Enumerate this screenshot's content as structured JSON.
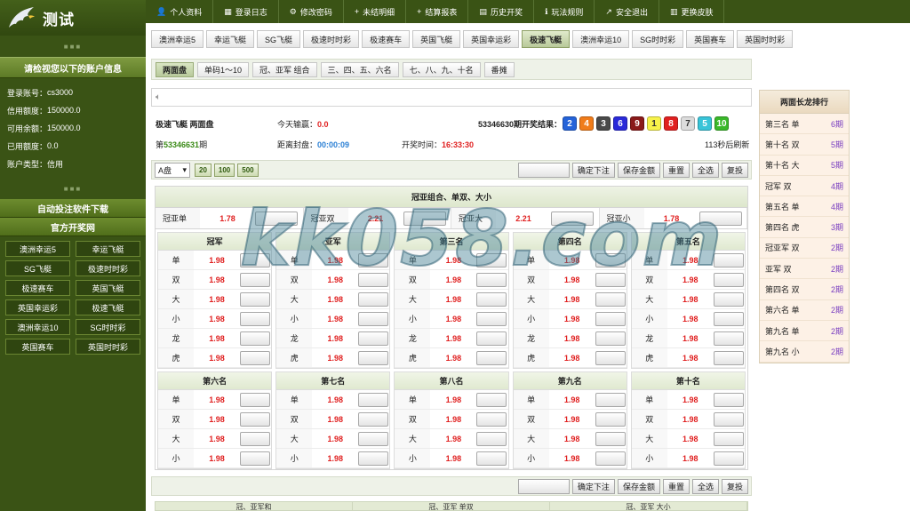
{
  "brand": {
    "title": "测试"
  },
  "sidebar": {
    "account_title": "请检视您以下的账户信息",
    "account": [
      {
        "label": "登录账号：",
        "value": "cs3000"
      },
      {
        "label": "信用额度：",
        "value": "150000.0"
      },
      {
        "label": "可用余额：",
        "value": "150000.0"
      },
      {
        "label": "已用额度：",
        "value": "0.0"
      },
      {
        "label": "账户类型：",
        "value": "信用"
      }
    ],
    "download_label": "自动投注软件下载",
    "official_label": "官方开奖网",
    "links": [
      "澳洲幸运5",
      "幸运飞艇",
      "SG飞艇",
      "极速时时彩",
      "极速赛车",
      "英国飞艇",
      "英国幸运彩",
      "极速飞艇",
      "澳洲幸运10",
      "SG时时彩",
      "英国赛车",
      "英国时时彩"
    ]
  },
  "topnav": [
    {
      "icon": "user-icon",
      "glyph": "👤",
      "label": "个人资料"
    },
    {
      "icon": "log-icon",
      "glyph": "▦",
      "label": "登录日志"
    },
    {
      "icon": "key-icon",
      "glyph": "⚙",
      "label": "修改密码"
    },
    {
      "icon": "plus-icon",
      "glyph": "+",
      "label": "未结明细"
    },
    {
      "icon": "plus-icon",
      "glyph": "+",
      "label": "结算报表"
    },
    {
      "icon": "history-icon",
      "glyph": "▤",
      "label": "历史开奖"
    },
    {
      "icon": "info-icon",
      "glyph": "ℹ",
      "label": "玩法规则"
    },
    {
      "icon": "exit-icon",
      "glyph": "↗",
      "label": "安全退出"
    },
    {
      "icon": "skin-icon",
      "glyph": "▥",
      "label": "更换皮肤"
    }
  ],
  "games": [
    "澳洲幸运5",
    "幸运飞艇",
    "SG飞艇",
    "极速时时彩",
    "极速赛车",
    "英国飞艇",
    "英国幸运彩",
    "极速飞艇",
    "澳洲幸运10",
    "SG时时彩",
    "英国赛车",
    "英国时时彩"
  ],
  "active_game": "极速飞艇",
  "plays": [
    "两面盘",
    "单码1～10",
    "冠、亚军 组合",
    "三、四、五、六名",
    "七、八、九、十名",
    "番摊"
  ],
  "active_play": "两面盘",
  "status": {
    "game_play": "极速飞艇 两面盘",
    "win_label": "今天输赢：",
    "win_value": "0.0",
    "result_label": "53346630期开奖结果：",
    "period_prefix": "第",
    "period_no": "53346631",
    "period_suffix": "期",
    "close_label": "距离封盘：",
    "close_value": "00:00:09",
    "open_label": "开奖时间：",
    "open_value": "16:33:30",
    "refresh": "113秒后刷新"
  },
  "balls": [
    {
      "n": "2",
      "bg": "#2563d9",
      "fg": "#ffffff"
    },
    {
      "n": "4",
      "bg": "#f07c1a",
      "fg": "#ffffff"
    },
    {
      "n": "3",
      "bg": "#4a4a4a",
      "fg": "#ffffff"
    },
    {
      "n": "6",
      "bg": "#2a2ad9",
      "fg": "#ffffff"
    },
    {
      "n": "9",
      "bg": "#8a1a1a",
      "fg": "#ffffff"
    },
    {
      "n": "1",
      "bg": "#f7f24a",
      "fg": "#333333"
    },
    {
      "n": "8",
      "bg": "#e02020",
      "fg": "#ffffff"
    },
    {
      "n": "7",
      "bg": "#dcdcdc",
      "fg": "#333333"
    },
    {
      "n": "5",
      "bg": "#38c4d8",
      "fg": "#ffffff"
    },
    {
      "n": "10",
      "bg": "#3ab82a",
      "fg": "#ffffff"
    }
  ],
  "toolbar": {
    "plate": "A盘",
    "quick": [
      "20",
      "100",
      "500"
    ],
    "confirm": "确定下注",
    "save": "保存金额",
    "reset": "重置",
    "select_all": "全选",
    "reverse": "复投"
  },
  "combo": {
    "title": "冠亚组合、单双、大小",
    "items": [
      {
        "label": "冠亚单",
        "odds": "1.78"
      },
      {
        "label": "冠亚双",
        "odds": "2.21"
      },
      {
        "label": "冠亚大",
        "odds": "2.21"
      },
      {
        "label": "冠亚小",
        "odds": "1.78"
      }
    ]
  },
  "ranks_top": [
    {
      "title": "冠军",
      "rows": [
        {
          "l": "单",
          "o": "1.98"
        },
        {
          "l": "双",
          "o": "1.98"
        },
        {
          "l": "大",
          "o": "1.98"
        },
        {
          "l": "小",
          "o": "1.98"
        },
        {
          "l": "龙",
          "o": "1.98"
        },
        {
          "l": "虎",
          "o": "1.98"
        }
      ]
    },
    {
      "title": "亚军",
      "rows": [
        {
          "l": "单",
          "o": "1.98"
        },
        {
          "l": "双",
          "o": "1.98"
        },
        {
          "l": "大",
          "o": "1.98"
        },
        {
          "l": "小",
          "o": "1.98"
        },
        {
          "l": "龙",
          "o": "1.98"
        },
        {
          "l": "虎",
          "o": "1.98"
        }
      ]
    },
    {
      "title": "第三名",
      "rows": [
        {
          "l": "单",
          "o": "1.98"
        },
        {
          "l": "双",
          "o": "1.98"
        },
        {
          "l": "大",
          "o": "1.98"
        },
        {
          "l": "小",
          "o": "1.98"
        },
        {
          "l": "龙",
          "o": "1.98"
        },
        {
          "l": "虎",
          "o": "1.98"
        }
      ]
    },
    {
      "title": "第四名",
      "rows": [
        {
          "l": "单",
          "o": "1.98"
        },
        {
          "l": "双",
          "o": "1.98"
        },
        {
          "l": "大",
          "o": "1.98"
        },
        {
          "l": "小",
          "o": "1.98"
        },
        {
          "l": "龙",
          "o": "1.98"
        },
        {
          "l": "虎",
          "o": "1.98"
        }
      ]
    },
    {
      "title": "第五名",
      "rows": [
        {
          "l": "单",
          "o": "1.98"
        },
        {
          "l": "双",
          "o": "1.98"
        },
        {
          "l": "大",
          "o": "1.98"
        },
        {
          "l": "小",
          "o": "1.98"
        },
        {
          "l": "龙",
          "o": "1.98"
        },
        {
          "l": "虎",
          "o": "1.98"
        }
      ]
    }
  ],
  "ranks_bottom": [
    {
      "title": "第六名",
      "rows": [
        {
          "l": "单",
          "o": "1.98"
        },
        {
          "l": "双",
          "o": "1.98"
        },
        {
          "l": "大",
          "o": "1.98"
        },
        {
          "l": "小",
          "o": "1.98"
        }
      ]
    },
    {
      "title": "第七名",
      "rows": [
        {
          "l": "单",
          "o": "1.98"
        },
        {
          "l": "双",
          "o": "1.98"
        },
        {
          "l": "大",
          "o": "1.98"
        },
        {
          "l": "小",
          "o": "1.98"
        }
      ]
    },
    {
      "title": "第八名",
      "rows": [
        {
          "l": "单",
          "o": "1.98"
        },
        {
          "l": "双",
          "o": "1.98"
        },
        {
          "l": "大",
          "o": "1.98"
        },
        {
          "l": "小",
          "o": "1.98"
        }
      ]
    },
    {
      "title": "第九名",
      "rows": [
        {
          "l": "单",
          "o": "1.98"
        },
        {
          "l": "双",
          "o": "1.98"
        },
        {
          "l": "大",
          "o": "1.98"
        },
        {
          "l": "小",
          "o": "1.98"
        }
      ]
    },
    {
      "title": "第十名",
      "rows": [
        {
          "l": "单",
          "o": "1.98"
        },
        {
          "l": "双",
          "o": "1.98"
        },
        {
          "l": "大",
          "o": "1.98"
        },
        {
          "l": "小",
          "o": "1.98"
        }
      ]
    }
  ],
  "bottom_tabs": [
    "冠、亚军和",
    "冠、亚军 单双",
    "冠、亚军 大小"
  ],
  "long_dragon": {
    "title": "两面长龙排行",
    "items": [
      {
        "name": "第三名 单",
        "count": "6期"
      },
      {
        "name": "第十名 双",
        "count": "5期"
      },
      {
        "name": "第十名 大",
        "count": "5期"
      },
      {
        "name": "冠军 双",
        "count": "4期"
      },
      {
        "name": "第五名 单",
        "count": "4期"
      },
      {
        "name": "第四名 虎",
        "count": "3期"
      },
      {
        "name": "冠亚军 双",
        "count": "2期"
      },
      {
        "name": "亚军 双",
        "count": "2期"
      },
      {
        "name": "第四名 双",
        "count": "2期"
      },
      {
        "name": "第六名 单",
        "count": "2期"
      },
      {
        "name": "第九名 单",
        "count": "2期"
      },
      {
        "name": "第九名 小",
        "count": "2期"
      }
    ]
  },
  "watermark": "kk058.com"
}
